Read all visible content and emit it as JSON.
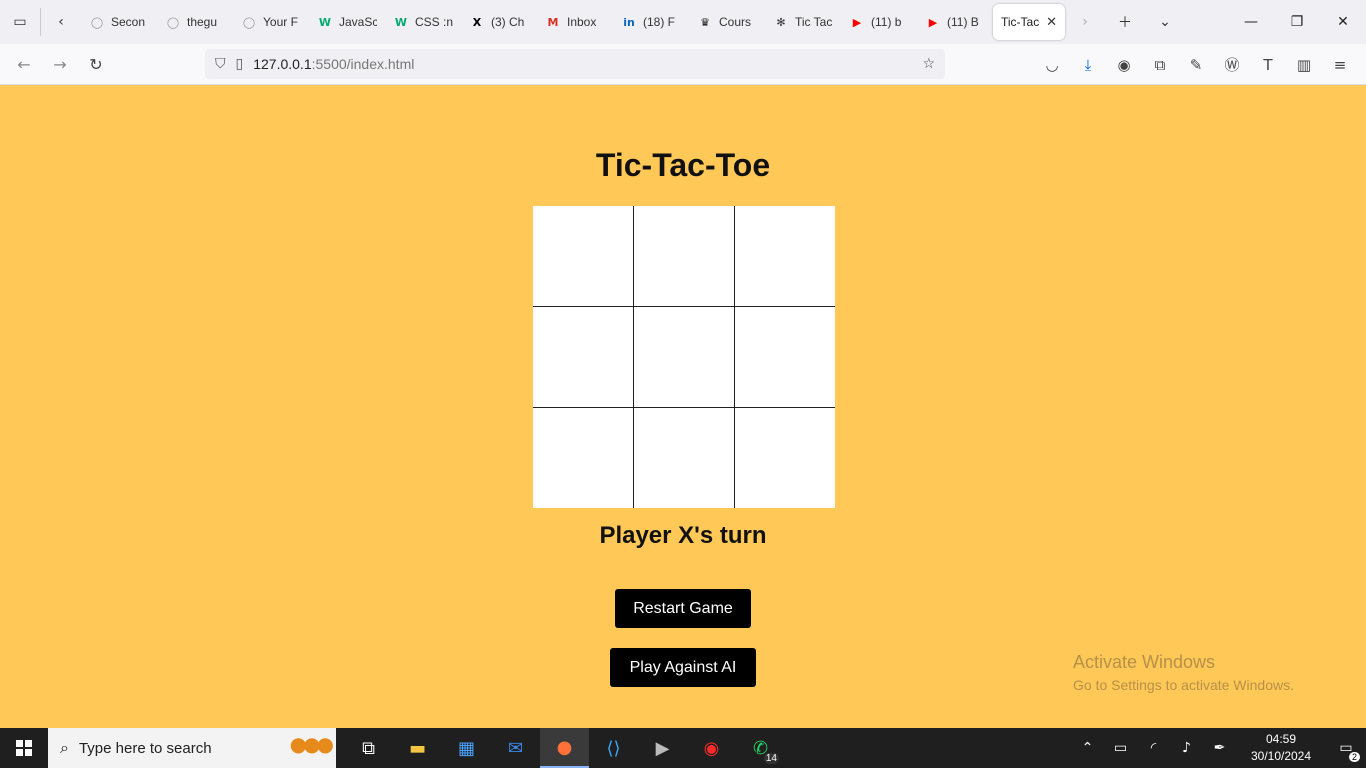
{
  "browser": {
    "tabs": [
      {
        "label": "Secon",
        "icon": "github-icon",
        "glyph": "◯",
        "color": "#999"
      },
      {
        "label": "thegu",
        "icon": "github-icon",
        "glyph": "◯",
        "color": "#999"
      },
      {
        "label": "Your F",
        "icon": "github-icon",
        "glyph": "◯",
        "color": "#999"
      },
      {
        "label": "JavaSc",
        "icon": "w3schools-icon",
        "glyph": "W",
        "color": "#04aa6d"
      },
      {
        "label": "CSS :n",
        "icon": "w3schools-icon",
        "glyph": "W",
        "color": "#04aa6d"
      },
      {
        "label": "(3) Ch",
        "icon": "x-icon",
        "glyph": "X",
        "color": "#000"
      },
      {
        "label": "Inbox",
        "icon": "gmail-icon",
        "glyph": "M",
        "color": "#d93025"
      },
      {
        "label": "(18) F",
        "icon": "linkedin-icon",
        "glyph": "in",
        "color": "#0a66c2"
      },
      {
        "label": "Cours",
        "icon": "crown-icon",
        "glyph": "♛",
        "color": "#111"
      },
      {
        "label": "Tic Tac",
        "icon": "chatgpt-icon",
        "glyph": "✻",
        "color": "#333"
      },
      {
        "label": "(11) b",
        "icon": "youtube-icon",
        "glyph": "▶",
        "color": "#ff0000"
      },
      {
        "label": "(11) B",
        "icon": "youtube-icon",
        "glyph": "▶",
        "color": "#ff0000"
      }
    ],
    "active_tab": {
      "label": "Tic-Tac-"
    },
    "url": {
      "host": "127.0.0.1",
      "path": ":5500/index.html"
    }
  },
  "game": {
    "title": "Tic-Tac-Toe",
    "cells": [
      "",
      "",
      "",
      "",
      "",
      "",
      "",
      "",
      ""
    ],
    "status": "Player X's turn",
    "restart_label": "Restart Game",
    "ai_label": "Play Against AI"
  },
  "watermark": {
    "line1": "Activate Windows",
    "line2": "Go to Settings to activate Windows."
  },
  "taskbar": {
    "search_placeholder": "Type here to search",
    "whatsapp_badge": "14",
    "time": "04:59",
    "date": "30/10/2024",
    "notifications": "2"
  },
  "colors": {
    "page_background": "#ffc857",
    "button_background": "#000000"
  }
}
